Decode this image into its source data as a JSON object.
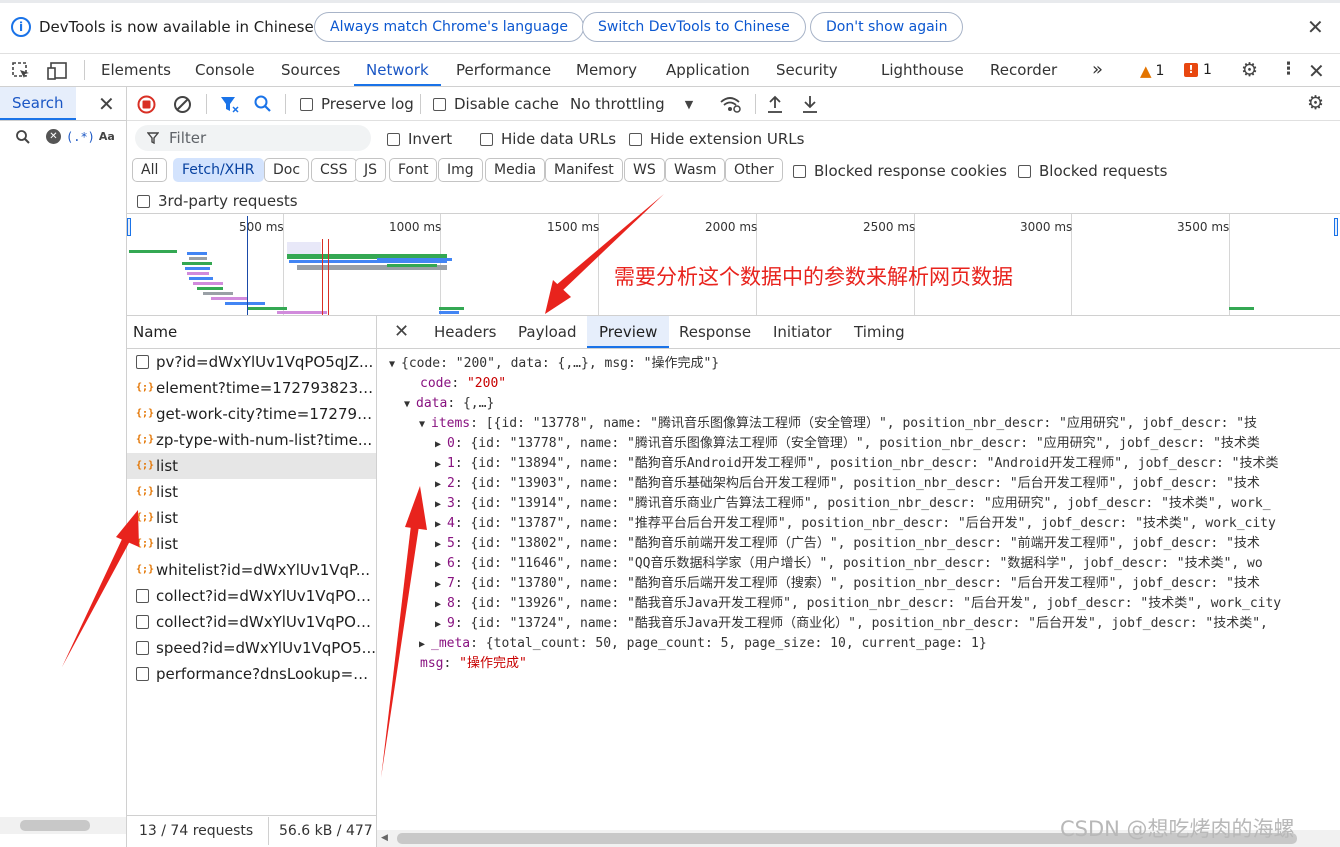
{
  "infobar": {
    "message": "DevTools is now available in Chinese!",
    "btn_match": "Always match Chrome's language",
    "btn_switch": "Switch DevTools to Chinese",
    "btn_dont": "Don't show again"
  },
  "tabs": [
    "Elements",
    "Console",
    "Sources",
    "Network",
    "Performance",
    "Memory",
    "Application",
    "Security",
    "Lighthouse",
    "Recorder"
  ],
  "active_tab": "Network",
  "warnings": {
    "warn_count": "1",
    "error_count": "1"
  },
  "search_tab": "Search",
  "toolbar": {
    "preserve_log": "Preserve log",
    "disable_cache": "Disable cache",
    "throttling": "No throttling"
  },
  "filter": {
    "placeholder": "Filter",
    "invert": "Invert",
    "hide_data_urls": "Hide data URLs",
    "hide_ext_urls": "Hide extension URLs"
  },
  "chips": [
    "All",
    "Fetch/XHR",
    "Doc",
    "CSS",
    "JS",
    "Font",
    "Img",
    "Media",
    "Manifest",
    "WS",
    "Wasm",
    "Other"
  ],
  "active_chip": "Fetch/XHR",
  "blocked_cookies": "Blocked response cookies",
  "blocked_requests": "Blocked requests",
  "third_party": "3rd-party requests",
  "timeline_labels": [
    "500 ms",
    "1000 ms",
    "1500 ms",
    "2000 ms",
    "2500 ms",
    "3000 ms",
    "3500 ms"
  ],
  "annotation": "需要分析这个数据中的参数来解析网页数据",
  "name_header": "Name",
  "requests": [
    {
      "name": "pv?id=dWxYlUv1VqPO5qJZ...",
      "icon": "doc-icon"
    },
    {
      "name": "element?time=1727938232...",
      "icon": "xhr-icon"
    },
    {
      "name": "get-work-city?time=172793...",
      "icon": "xhr-icon"
    },
    {
      "name": "zp-type-with-num-list?time...",
      "icon": "xhr-icon"
    },
    {
      "name": "list",
      "icon": "xhr-icon"
    },
    {
      "name": "list",
      "icon": "xhr-icon"
    },
    {
      "name": "list",
      "icon": "xhr-icon"
    },
    {
      "name": "list",
      "icon": "xhr-icon"
    },
    {
      "name": "whitelist?id=dWxYlUv1VqP...",
      "icon": "xhr-icon"
    },
    {
      "name": "collect?id=dWxYlUv1VqPO5...",
      "icon": "doc-icon"
    },
    {
      "name": "collect?id=dWxYlUv1VqPO5...",
      "icon": "doc-icon"
    },
    {
      "name": "speed?id=dWxYlUv1VqPO5...",
      "icon": "doc-icon"
    },
    {
      "name": "performance?dnsLookup=0...",
      "icon": "doc-icon"
    }
  ],
  "selected_request_index": 4,
  "status": {
    "requests": "13 / 74 requests",
    "size": "56.6 kB / 477"
  },
  "detail_tabs": [
    "Headers",
    "Payload",
    "Preview",
    "Response",
    "Initiator",
    "Timing"
  ],
  "active_detail_tab": "Preview",
  "preview": {
    "root": "{code: \"200\", data: {,…}, msg: \"操作完成\"}",
    "code_key": "code",
    "code_val": "\"200\"",
    "data_key": "data",
    "data_val": "{,…}",
    "items_key": "items",
    "items_val": "[{id: \"13778\", name: \"腾讯音乐图像算法工程师（安全管理）\", position_nbr_descr: \"应用研究\", jobf_descr: \"技",
    "items": [
      {
        "idx": "0",
        "text": "{id: \"13778\", name: \"腾讯音乐图像算法工程师（安全管理）\", position_nbr_descr: \"应用研究\", jobf_descr: \"技术类"
      },
      {
        "idx": "1",
        "text": "{id: \"13894\", name: \"酷狗音乐Android开发工程师\", position_nbr_descr: \"Android开发工程师\", jobf_descr: \"技术类"
      },
      {
        "idx": "2",
        "text": "{id: \"13903\", name: \"酷狗音乐基础架构后台开发工程师\", position_nbr_descr: \"后台开发工程师\", jobf_descr: \"技术"
      },
      {
        "idx": "3",
        "text": "{id: \"13914\", name: \"腾讯音乐商业广告算法工程师\", position_nbr_descr: \"应用研究\", jobf_descr: \"技术类\", work_"
      },
      {
        "idx": "4",
        "text": "{id: \"13787\", name: \"推荐平台后台开发工程师\", position_nbr_descr: \"后台开发\", jobf_descr: \"技术类\", work_city"
      },
      {
        "idx": "5",
        "text": "{id: \"13802\", name: \"酷狗音乐前端开发工程师（广告）\", position_nbr_descr: \"前端开发工程师\", jobf_descr: \"技术"
      },
      {
        "idx": "6",
        "text": "{id: \"11646\", name: \"QQ音乐数据科学家（用户增长）\", position_nbr_descr: \"数据科学\", jobf_descr: \"技术类\", wo"
      },
      {
        "idx": "7",
        "text": "{id: \"13780\", name: \"酷狗音乐后端开发工程师（搜索）\", position_nbr_descr: \"后台开发工程师\", jobf_descr: \"技术"
      },
      {
        "idx": "8",
        "text": "{id: \"13926\", name: \"酷我音乐Java开发工程师\", position_nbr_descr: \"后台开发\", jobf_descr: \"技术类\", work_city"
      },
      {
        "idx": "9",
        "text": "{id: \"13724\", name: \"酷我音乐Java开发工程师（商业化）\", position_nbr_descr: \"后台开发\", jobf_descr: \"技术类\","
      }
    ],
    "meta_key": "_meta",
    "meta_val": "{total_count: 50, page_count: 5, page_size: 10, current_page: 1}",
    "msg_key": "msg",
    "msg_val": "\"操作完成\""
  },
  "watermark": "CSDN @想吃烤肉的海螺",
  "colors": {
    "accent": "#1a73e8",
    "annotation": "#e8231d",
    "warning": "#e37400",
    "error": "#d93025"
  }
}
